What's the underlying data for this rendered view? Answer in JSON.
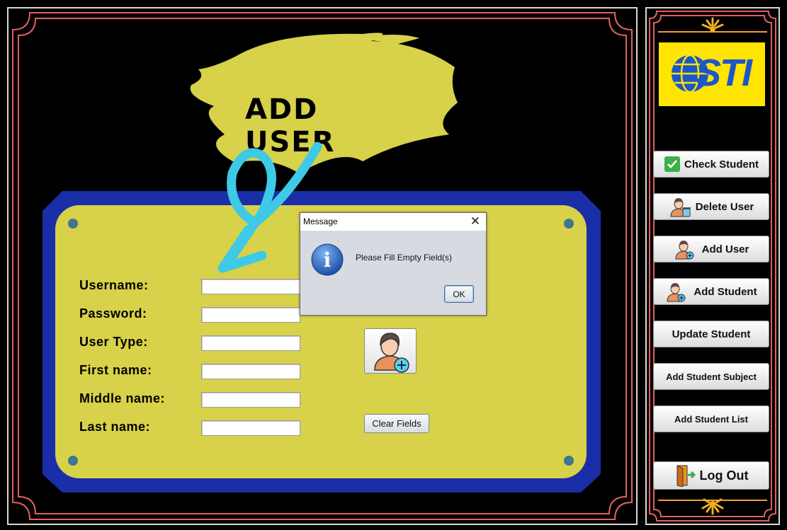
{
  "form": {
    "title": "ADD USER",
    "labels": {
      "username": "Username:",
      "password": "Password:",
      "user_type": "User Type:",
      "first_name": "First name:",
      "middle_name": "Middle name:",
      "last_name": "Last name:"
    },
    "values": {
      "username": "",
      "password": "",
      "user_type": "",
      "first_name": "",
      "middle_name": "",
      "last_name": ""
    },
    "add_user_icon": "add-user-icon",
    "clear_label": "Clear Fields"
  },
  "dialog": {
    "title": "Message",
    "message": "Please Fill Empty Field(s)",
    "ok_label": "OK",
    "icon": "info-icon"
  },
  "sidebar": {
    "logo_text": "STI",
    "items": [
      {
        "label": "Check Student",
        "icon": "checkmark-icon"
      },
      {
        "label": "Delete User",
        "icon": "delete-user-icon"
      },
      {
        "label": "Add User",
        "icon": "add-user-icon"
      },
      {
        "label": "Add Student",
        "icon": "add-student-icon"
      },
      {
        "label": "Update Student",
        "icon": ""
      },
      {
        "label": "Add Student Subject",
        "icon": ""
      },
      {
        "label": "Add Student List",
        "icon": ""
      }
    ],
    "logout_label": "Log Out",
    "logout_icon": "logout-door-icon"
  },
  "colors": {
    "frame_red": "#e06060",
    "card_yellow": "#d8d14a",
    "card_blue": "#1a2ea8",
    "accent_cyan": "#3ec9e6",
    "logo_blue": "#1c56c9",
    "logo_yellow": "#ffe500"
  }
}
